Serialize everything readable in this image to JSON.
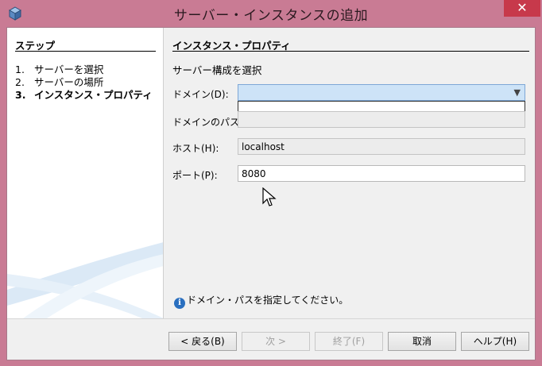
{
  "window": {
    "title": "サーバー・インスタンスの追加",
    "close_glyph": "✕"
  },
  "steps": {
    "heading": "ステップ",
    "items": [
      {
        "num": "1.",
        "label": "サーバーを選択"
      },
      {
        "num": "2.",
        "label": "サーバーの場所"
      },
      {
        "num": "3.",
        "label": "インスタンス・プロパティ"
      }
    ],
    "current_index": 2
  },
  "panel": {
    "title": "インスタンス・プロパティ",
    "subtitle": "サーバー構成を選択",
    "domain": {
      "label": "ドメイン(D):",
      "value": ""
    },
    "domain_path": {
      "label": "ドメインのパス:",
      "value": ""
    },
    "host": {
      "label": "ホスト(H):",
      "value": "localhost"
    },
    "port": {
      "label": "ポート(P):",
      "value": "8080"
    },
    "info_icon": "i",
    "info_message": "ドメイン・パスを指定してください。"
  },
  "buttons": {
    "back": "< 戻る(B)",
    "next": "次 >",
    "finish": "終了(F)",
    "cancel": "取消",
    "help": "ヘルプ(H)"
  },
  "colors": {
    "titlebar": "#c97b94",
    "close": "#c7394b",
    "combo_selected": "#cde3f7"
  }
}
